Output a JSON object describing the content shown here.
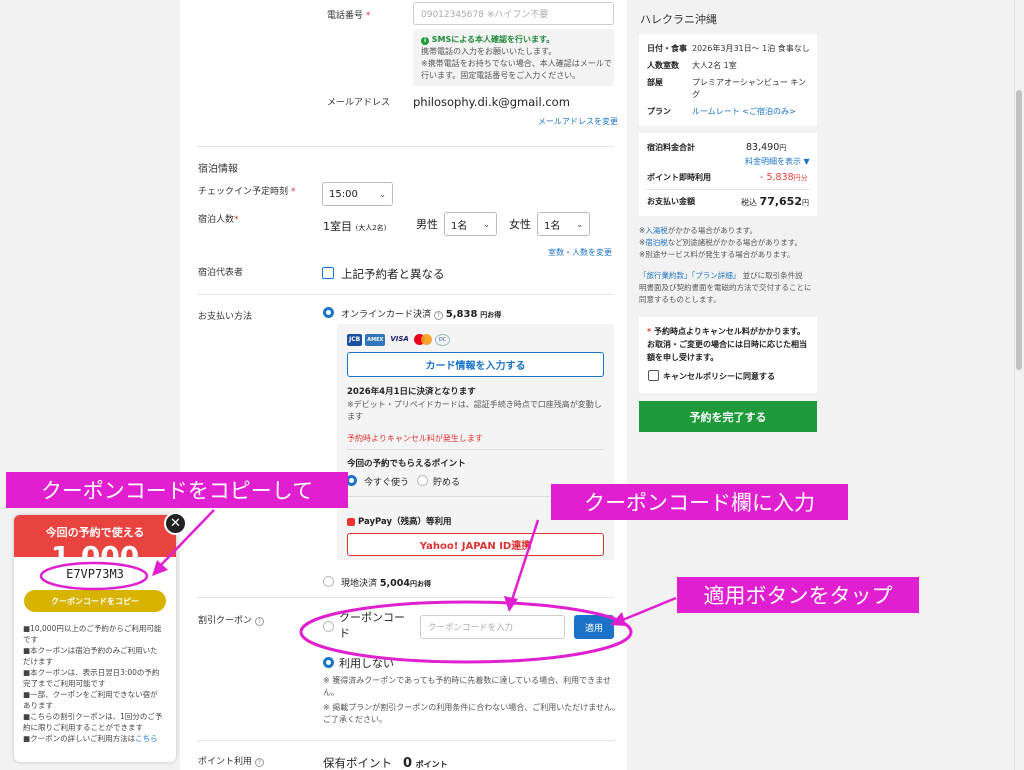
{
  "contact": {
    "phone_label": "電話番号",
    "required_mark": "*",
    "phone_placeholder": "09012345678 ※ハイフン不要",
    "sms_title": "SMSによる本人確認を行います。",
    "sms_line1": "携帯電話の入力をお願いいたします。",
    "sms_line2": "※携帯電話をお持ちでない場合、本人確認はメールで",
    "sms_line3": "行います。固定電話番号をご入力ください。",
    "email_label": "メールアドレス",
    "email_value": "philosophy.di.k@gmail.com",
    "email_change": "メールアドレスを変更"
  },
  "stay": {
    "section_title": "宿泊情報",
    "checkin_label": "チェックイン予定時刻",
    "checkin_value": "15:00",
    "guests_label": "宿泊人数",
    "room_label": "1室目",
    "room_sub": "(大人2名)",
    "male_label": "男性",
    "male_value": "1名",
    "female_label": "女性",
    "female_value": "1名",
    "change_link": "室数・人数を変更",
    "rep_label": "宿泊代表者",
    "rep_checkbox": "上記予約者と異なる"
  },
  "payment": {
    "label": "お支払い方法",
    "online_label": "オンラインカード決済",
    "online_amount": "5,838",
    "online_suffix": "円お得",
    "card_logos": [
      "JCB",
      "AMEX",
      "VISA",
      "MC",
      "DC"
    ],
    "card_button": "カード情報を入力する",
    "settle_date": "2026年4月1日に決済となります",
    "debit_note": "※デビット・プリペイドカードは、認証手続き時点で口座残高が変動し",
    "debit_note2": "ます",
    "cancel_warn": "予約時よりキャンセル料が発生します",
    "points_title": "今回の予約でもらえるポイント",
    "use_now": "今すぐ使う",
    "save": "貯める",
    "paypay_label": "PayPay（残高）等利用",
    "yahoo_button": "Yahoo! JAPAN ID連携",
    "onsite_label": "現地決済",
    "onsite_amount": "5,004",
    "onsite_suffix": "円お得"
  },
  "coupon": {
    "label": "割引クーポン",
    "code_label_1": "クーポンコー",
    "code_label_2": "ド",
    "input_placeholder": "クーポンコードを入力",
    "apply_button": "適用",
    "not_use": "利用しない",
    "note1": "※ 獲得済みクーポンであっても予約時に先着数に達している場合、利用できませ",
    "note1b": "ん。",
    "note2": "※ 掲載プランが割引クーポンの利用条件に合わない場合、ご利用いただけません。",
    "note2b": "ご了承ください。"
  },
  "points": {
    "label": "ポイント利用",
    "owned_label": "保有ポイント",
    "owned_value": "0",
    "owned_unit": "ポイント"
  },
  "summary": {
    "hotel_name": "ハレクラニ沖縄",
    "date_label": "日付・食事",
    "date_value": "2026年3月31日〜 1泊 食事なし",
    "guests_label": "人数室数",
    "guests_value": "大人2名 1室",
    "room_label": "部屋",
    "room_value1": "プレミアオーシャンビュー キン",
    "room_value2": "グ",
    "plan_label": "プラン",
    "plan_value": "ルームレート <ご宿泊のみ>",
    "total_label": "宿泊料金合計",
    "total_value": "83,490",
    "yen": "円",
    "breakdown_link": "料金明細を表示 ▼",
    "point_label": "ポイント即時利用",
    "point_value": "- 5,838",
    "point_unit": "円分",
    "pay_label": "お支払い金額",
    "tax_label": "税込",
    "pay_value": "77,652",
    "note1_link": "入湯税",
    "note1": "がかかる場合があります。",
    "note2_link": "宿泊税",
    "note2": "など別途諸税がかかる場合があります。",
    "note3": "※別途サービス料が発生する場合があります。",
    "terms1_link": "「旅行業約款」",
    "terms2_link": "「プラン詳細」",
    "terms_text1": "並びに取引条件説",
    "terms_text2": "明書面及び契約書面を電磁的方法で交付することに",
    "terms_text3": "同意するものとします。",
    "cancel_note1": "予約時点よりキャンセル料がかかります。",
    "cancel_note2": "お取消・ご変更の場合には日時に応じた相当",
    "cancel_note3": "額を申し受けます。",
    "cancel_agree": "キャンセルポリシーに同意する",
    "complete_button": "予約を完了する"
  },
  "popup": {
    "title": "今回の予約で使える",
    "big_amount": "1,000",
    "code": "E7VP73M3",
    "copy_button": "クーポンコードをコピー",
    "notes": [
      "■10,000円以上のご予約からご利用可能",
      "です",
      "■本クーポンは宿泊予約のみご利用いた",
      "だけます",
      "■本クーポンは、表示日翌日3:00の予約",
      "完了までご利用可能です",
      "■一部、クーポンをご利用できない宿が",
      "あります",
      "■こちらの割引クーポンは、1回分のご予",
      "約に限りご利用することができます"
    ],
    "detail_text": "■クーポンの詳しいご利用方法は",
    "detail_link": "こちら"
  },
  "annotations": {
    "copy": "クーポンコードをコピーして",
    "enter": "クーポンコード欄に入力",
    "apply": "適用ボタンをタップ"
  },
  "colors": {
    "accent": "#1a73c8",
    "annotation": "#e020d0",
    "complete": "#1e9a3a",
    "popup_red": "#e9433f",
    "copy_yellow": "#d8b400",
    "point_red": "#e0403a"
  }
}
